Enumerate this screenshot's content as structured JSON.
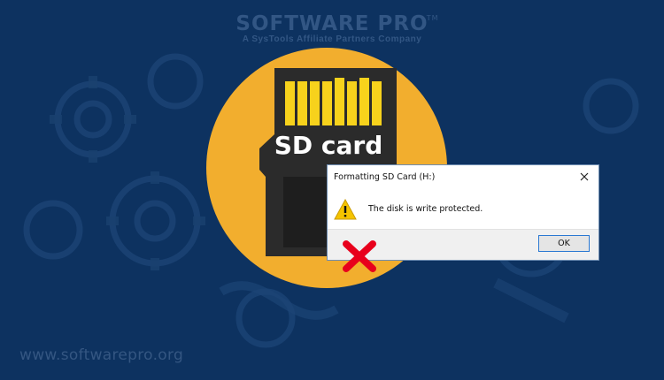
{
  "brand": {
    "name": "SOFTWARE PRO",
    "trademark": "TM",
    "tagline": "A SysTools Affiliate Partners Company"
  },
  "watermark_url": "www.softwarepro.org",
  "sd_card": {
    "label": "SD card"
  },
  "dialog": {
    "title": "Formatting SD Card (H:)",
    "message": "The disk is write protected.",
    "ok_label": "OK",
    "close_icon": "close-icon",
    "warning_icon": "warning-icon"
  },
  "colors": {
    "background": "#0d3260",
    "circle": "#f2ae2e",
    "card_body": "#2e2e2e",
    "contacts": "#f7d21c",
    "error_x": "#e8001c",
    "warning": "#f5c400"
  }
}
